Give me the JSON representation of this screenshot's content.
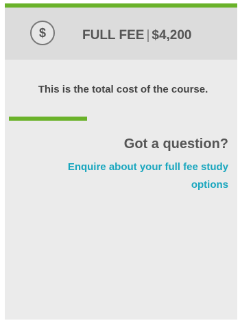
{
  "fee_card": {
    "icon": "dollar-icon",
    "icon_glyph": "$",
    "title": "FULL FEE",
    "separator": "|",
    "amount": "$4,200",
    "description": "This is the total cost of the course.",
    "question": "Got a question?",
    "enquire_link": "Enquire about your full fee study options"
  },
  "colors": {
    "accent_green": "#6ab22a",
    "link_teal": "#18a6be",
    "card_bg": "#ebebeb",
    "header_bg": "#dcdcdc"
  }
}
